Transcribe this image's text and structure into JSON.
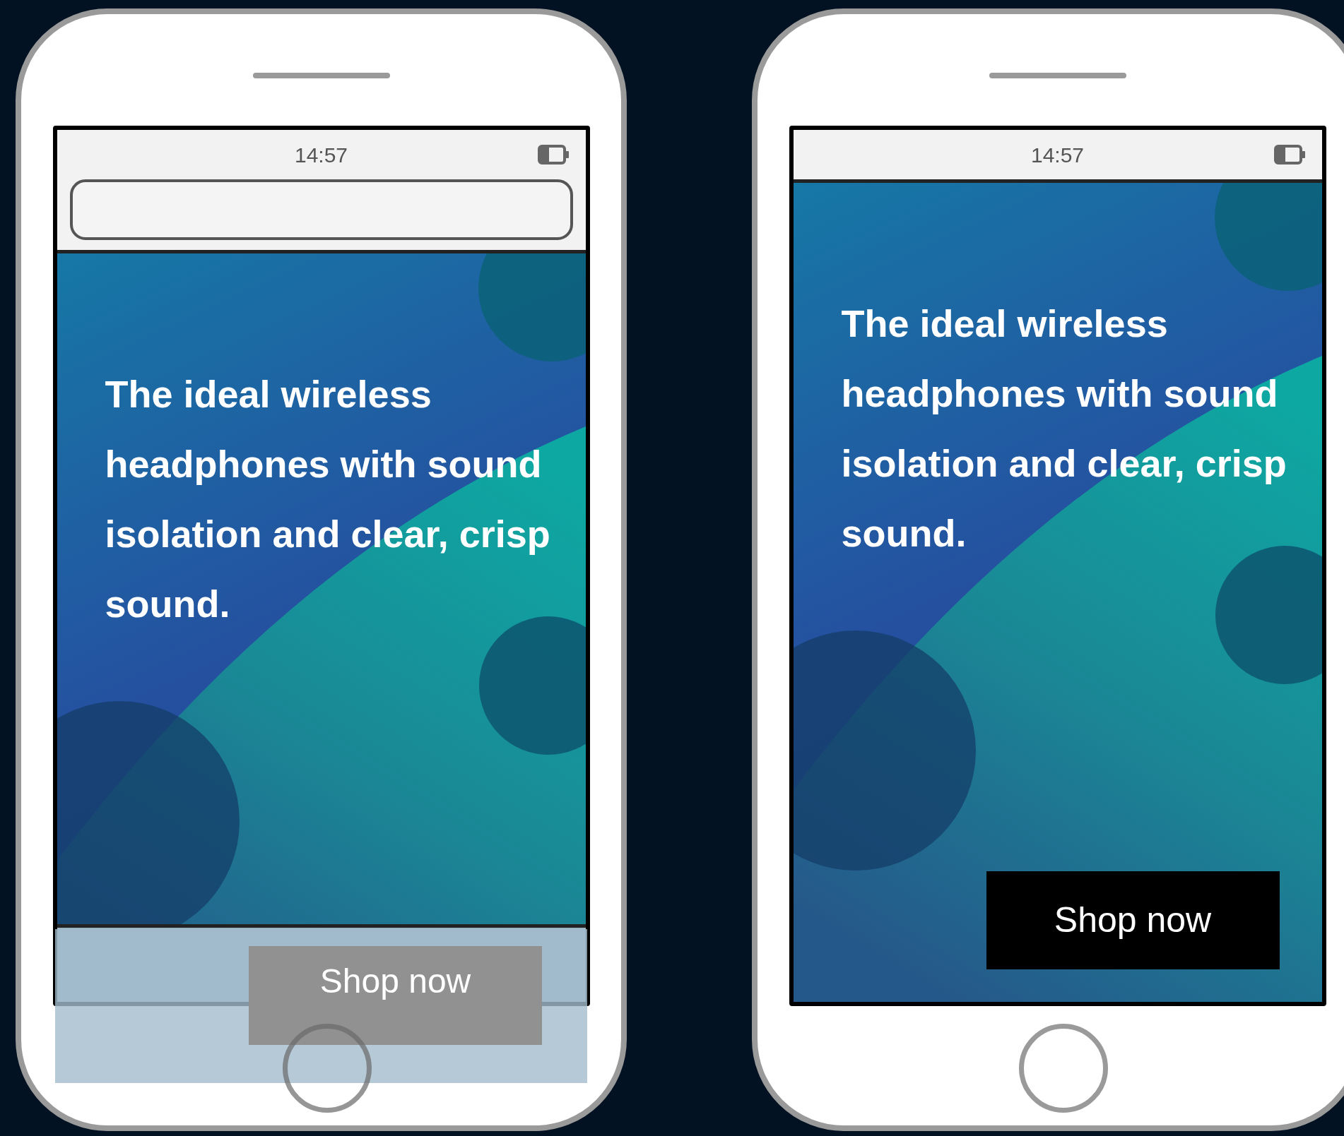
{
  "phones": [
    {
      "kind": "browser",
      "time": "14:57",
      "headline": "The ideal wireless headphones with sound isolation and clear, crisp sound.",
      "cta": {
        "label": "Shop now",
        "kind": "overlay"
      }
    },
    {
      "kind": "app",
      "time": "14:57",
      "headline": "The ideal wireless headphones with sound isolation and clear, crisp sound.",
      "cta": {
        "label": "Shop now",
        "kind": "solid"
      }
    }
  ]
}
